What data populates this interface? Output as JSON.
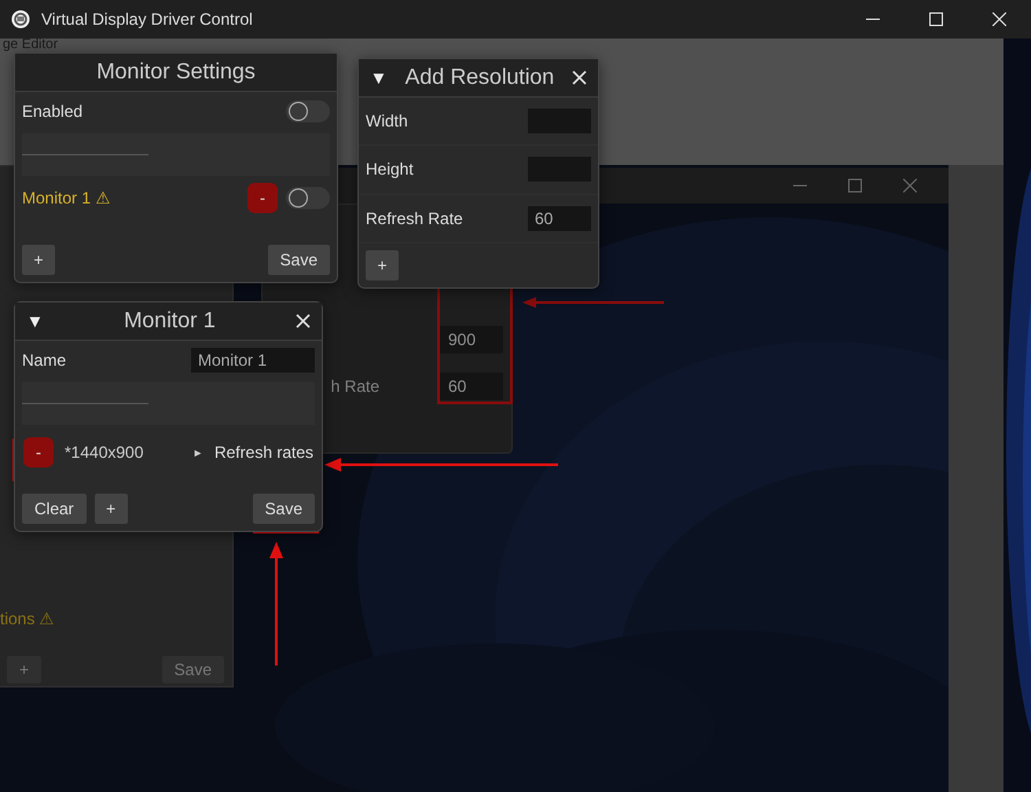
{
  "window": {
    "title": "Virtual Display Driver Control"
  },
  "background_window": {
    "title": "ge Editor"
  },
  "background_dialog": {
    "fields": [
      {
        "value": "900"
      },
      {
        "label": "h Rate",
        "value": "60"
      }
    ]
  },
  "background_panel": {
    "item": {
      "label": "tions ⚠",
      "warning": true
    },
    "buttons": [
      {
        "label": "+",
        "disabled": true
      },
      {
        "label": "Save",
        "disabled": true
      }
    ]
  },
  "monitor_settings": {
    "title": "Monitor Settings",
    "enabled": {
      "label": "Enabled",
      "on": false
    },
    "monitors": [
      {
        "label": "Monitor 1 ⚠",
        "warning": true,
        "remove": "-",
        "on": false
      }
    ],
    "buttons": [
      {
        "label": "+"
      },
      {
        "label": "Save"
      }
    ]
  },
  "add_resolution": {
    "collapse": "▼",
    "title": "Add Resolution",
    "fields": [
      {
        "label": "Width"
      },
      {
        "label": "Height"
      },
      {
        "label": "Refresh Rate",
        "value": "60"
      }
    ],
    "button": "+"
  },
  "monitor_panel": {
    "collapse": "▼",
    "title": "Monitor 1",
    "name": {
      "label": "Name",
      "value": "Monitor 1"
    },
    "resolutions": [
      {
        "remove": "-",
        "label": "*1440x900",
        "expander": "►",
        "refresh": "Refresh rates",
        "expanded": false
      }
    ],
    "buttons": [
      {
        "label": "Clear"
      },
      {
        "label": "+"
      }
    ],
    "save": "Save"
  }
}
